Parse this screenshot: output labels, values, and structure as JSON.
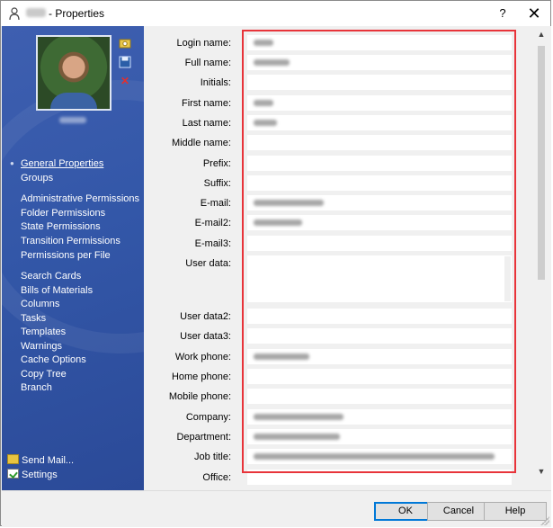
{
  "window": {
    "title": "- Properties",
    "help_label": "?",
    "close_label": "✕"
  },
  "sidebar": {
    "nav": [
      {
        "label": "General Properties",
        "active": true
      },
      {
        "label": "Groups"
      },
      {
        "label": "Administrative Permissions"
      },
      {
        "label": "Folder Permissions"
      },
      {
        "label": "State Permissions"
      },
      {
        "label": "Transition Permissions"
      },
      {
        "label": "Permissions per File"
      },
      {
        "label": "Search Cards"
      },
      {
        "label": "Bills of Materials"
      },
      {
        "label": "Columns"
      },
      {
        "label": "Tasks"
      },
      {
        "label": "Templates"
      },
      {
        "label": "Warnings"
      },
      {
        "label": "Cache Options"
      },
      {
        "label": "Copy Tree"
      },
      {
        "label": "Branch"
      }
    ],
    "send_mail": "Send Mail...",
    "settings": "Settings"
  },
  "form": {
    "fields": [
      {
        "label": "Login name:"
      },
      {
        "label": "Full name:"
      },
      {
        "label": "Initials:"
      },
      {
        "label": "First name:"
      },
      {
        "label": "Last name:"
      },
      {
        "label": "Middle name:"
      },
      {
        "label": "Prefix:"
      },
      {
        "label": "Suffix:"
      },
      {
        "label": "E-mail:"
      },
      {
        "label": "E-mail2:"
      },
      {
        "label": "E-mail3:"
      },
      {
        "label": "User data:"
      },
      {
        "label": "User data2:"
      },
      {
        "label": "User data3:"
      },
      {
        "label": "Work phone:"
      },
      {
        "label": "Home phone:"
      },
      {
        "label": "Mobile phone:"
      },
      {
        "label": "Company:"
      },
      {
        "label": "Department:"
      },
      {
        "label": "Job title:"
      },
      {
        "label": "Office:"
      }
    ]
  },
  "buttons": {
    "ok": "OK",
    "cancel": "Cancel",
    "help": "Help"
  },
  "colors": {
    "sidebar": "#3357a8",
    "highlight": "#e8343a",
    "ok_border": "#0078d7"
  }
}
